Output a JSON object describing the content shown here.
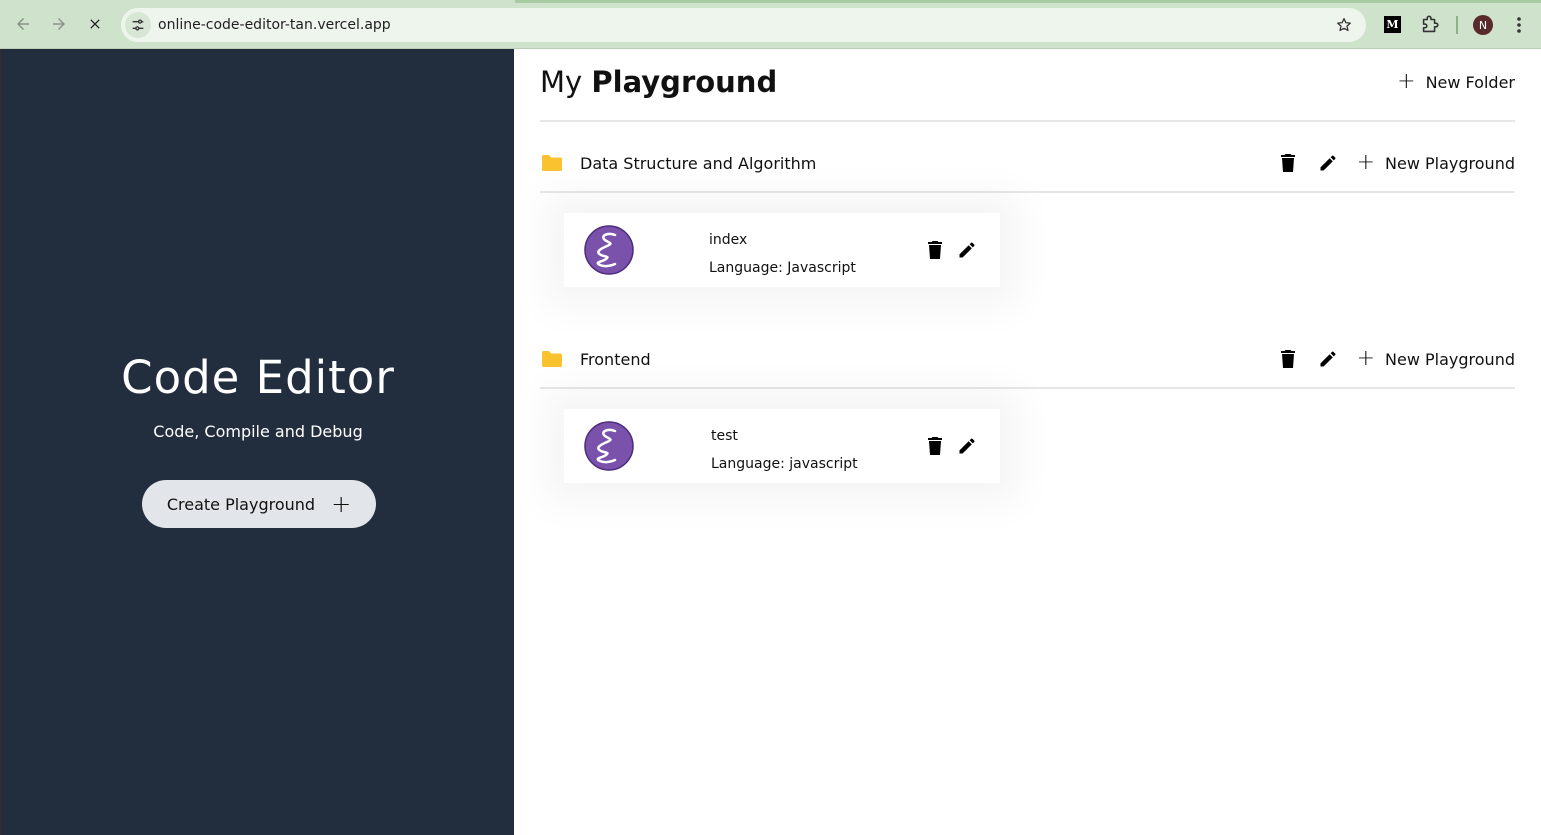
{
  "browser": {
    "url": "online-code-editor-tan.vercel.app",
    "extension_label": "M",
    "profile_initial": "N"
  },
  "hero": {
    "title": "Code Editor",
    "subtitle": "Code, Compile and Debug",
    "create_button_label": "Create Playground",
    "create_button_icon": "+"
  },
  "main": {
    "title_light": "My",
    "title_bold": "Playground",
    "new_folder_label": "New Folder",
    "plus": "+",
    "folders": [
      {
        "name": "Data Structure and Algorithm",
        "new_playground_label": "New Playground",
        "cards": [
          {
            "name": "index",
            "language": "Language: Javascript"
          }
        ]
      },
      {
        "name": "Frontend",
        "new_playground_label": "New Playground",
        "cards": [
          {
            "name": "test",
            "language": "Language: javascript"
          }
        ]
      }
    ]
  },
  "colors": {
    "hero_bg": "#222d3e",
    "folder": "#f9c22e",
    "logo": "#7b52ab",
    "chrome": "#cfe3cc"
  }
}
